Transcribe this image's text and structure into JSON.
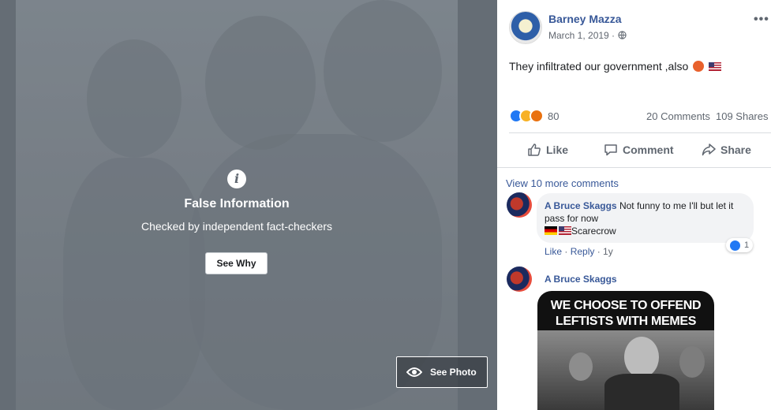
{
  "photo_overlay": {
    "title": "False Information",
    "subtitle": "Checked by independent fact-checkers",
    "see_why_label": "See Why",
    "see_photo_label": "See Photo",
    "icons": {
      "info": "info-icon",
      "eye": "eye-icon"
    }
  },
  "post": {
    "author": "Barney Mazza",
    "date": "March 1, 2019 ·",
    "text": "They infiltrated our government ,also",
    "reaction_count": "80",
    "comments_count": "20 Comments",
    "shares_count": "109 Shares",
    "actions": {
      "like": "Like",
      "comment": "Comment",
      "share": "Share"
    }
  },
  "comments": {
    "view_more": "View 10 more comments",
    "items": [
      {
        "author": "A Bruce Skaggs",
        "text": "Not funny to me I'll but let it pass for now",
        "signature": "Scarecrow",
        "like_label": "Like",
        "reply_label": "Reply",
        "age": "1y",
        "reaction_count": "1"
      },
      {
        "author": "A Bruce Skaggs",
        "meme_text": "WE CHOOSE TO OFFEND LEFTISTS WITH MEMES"
      }
    ]
  },
  "colors": {
    "link": "#385898",
    "muted": "#606770",
    "like_blue": "#2078f4"
  }
}
